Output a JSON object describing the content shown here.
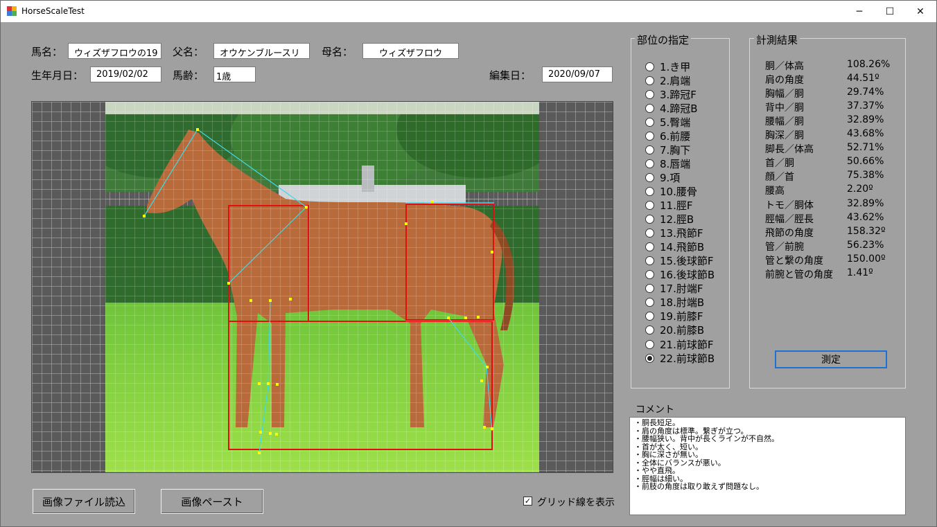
{
  "window": {
    "title": "HorseScaleTest"
  },
  "window_controls": {
    "minimize": "─",
    "maximize": "☐",
    "close": "✕"
  },
  "info": {
    "horse_name_label": "馬名：",
    "horse_name_value": "ウィズザフロウの19",
    "sire_label": "父名：",
    "sire_value": "オウケンブルースリ",
    "dam_label": "母名：",
    "dam_value": "ウィズザフロウ",
    "birthdate_label": "生年月日：",
    "birthdate_value": "2019/02/02",
    "age_label": "馬齢：",
    "age_value": "1歳",
    "edit_date_label": "編集日：",
    "edit_date_value": "2020/09/07"
  },
  "buttons": {
    "load_image": "画像ファイル読込",
    "paste_image": "画像ペースト",
    "measure": "測定"
  },
  "grid_toggle": {
    "label": "グリッド線を表示",
    "checked": true,
    "mark": "✓"
  },
  "parts": {
    "title": "部位の指定",
    "items": [
      "1.き甲",
      "2.肩端",
      "3.蹄冠F",
      "4.蹄冠B",
      "5.臀端",
      "6.前腰",
      "7.胸下",
      "8.唇端",
      "9.項",
      "10.腰骨",
      "11.脛F",
      "12.脛B",
      "13.飛節F",
      "14.飛節B",
      "15.後球節F",
      "16.後球節B",
      "17.肘端F",
      "18.肘端B",
      "19.前膝F",
      "20.前膝B",
      "21.前球節F",
      "22.前球節B"
    ],
    "selected_index": 21
  },
  "results": {
    "title": "計測結果",
    "rows": [
      {
        "label": "胴／体高",
        "value": "108.26%"
      },
      {
        "label": "肩の角度",
        "value": "44.51º"
      },
      {
        "label": "胸幅／胴",
        "value": "29.74%"
      },
      {
        "label": "背中／胴",
        "value": "37.37%"
      },
      {
        "label": "腰幅／胴",
        "value": "32.89%"
      },
      {
        "label": "胸深／胴",
        "value": "43.68%"
      },
      {
        "label": "脚長／体高",
        "value": "52.71%"
      },
      {
        "label": "首／胴",
        "value": "50.66%"
      },
      {
        "label": "顔／首",
        "value": "75.38%"
      },
      {
        "label": "腰高",
        "value": "2.20º"
      },
      {
        "label": "トモ／胴体",
        "value": "32.89%"
      },
      {
        "label": "脛幅／脛長",
        "value": "43.62%"
      },
      {
        "label": "飛節の角度",
        "value": "158.32º"
      },
      {
        "label": "管／前腕",
        "value": "56.23%"
      },
      {
        "label": "管と繋の角度",
        "value": "150.00º"
      },
      {
        "label": "前腕と管の角度",
        "value": "1.41º"
      }
    ]
  },
  "comment": {
    "title": "コメント",
    "lines": [
      "・胴長短足。",
      "・肩の角度は標準。繋ぎが立つ。",
      "・腰幅狭い。背中が長くラインが不自然。",
      "・首が太く、短い。",
      "・胸に深さが無い。",
      "・全体にバランスが悪い。",
      "・やや直飛。",
      "・脛幅は細い。",
      "・前肢の角度は取り敢えず問題なし。"
    ]
  },
  "colors": {
    "form_bg": "#a0a0a0",
    "measure_box": "#e01010",
    "measure_line": "#40d8e8",
    "measure_point": "#ffff00"
  }
}
